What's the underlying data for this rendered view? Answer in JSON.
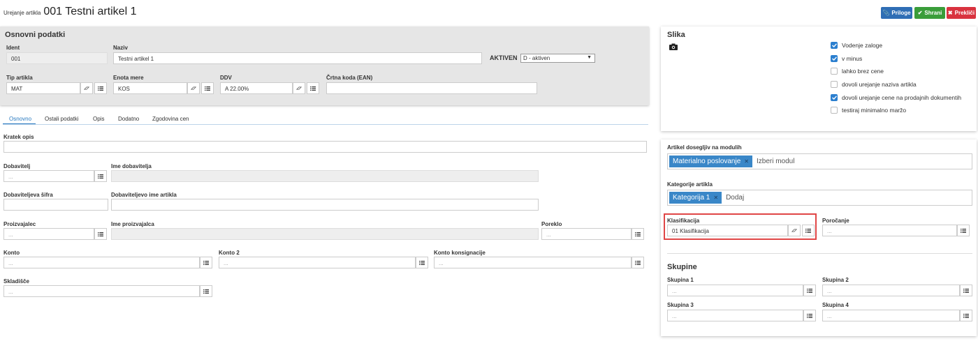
{
  "header": {
    "subtitle": "Urejanje artikla",
    "title": "001 Testni artikel 1",
    "buttons": {
      "priloge": "Priloge",
      "shrani": "Shrani",
      "preklici": "Prekliči"
    }
  },
  "basic": {
    "section_title": "Osnovni podatki",
    "ident_label": "Ident",
    "ident_value": "001",
    "naziv_label": "Naziv",
    "naziv_value": "Testni artikel 1",
    "aktiven_label": "AKTIVEN",
    "aktiven_value": "D - aktiven",
    "tip_label": "Tip artikla",
    "tip_value": "MAT",
    "enota_label": "Enota mere",
    "enota_value": "KOS",
    "ddv_label": "DDV",
    "ddv_value": "A 22.00%",
    "ean_label": "Črtna koda (EAN)",
    "ean_value": ""
  },
  "tabs": [
    {
      "label": "Osnovno",
      "active": true
    },
    {
      "label": "Ostali podatki",
      "active": false
    },
    {
      "label": "Opis",
      "active": false
    },
    {
      "label": "Dodatno",
      "active": false
    },
    {
      "label": "Zgodovina cen",
      "active": false
    }
  ],
  "form": {
    "kratek_opis_label": "Kratek opis",
    "dobavitelj_label": "Dobavitelj",
    "dobavitelj_placeholder": "...",
    "ime_dobavitelja_label": "Ime dobavitelja",
    "dob_sifra_label": "Dobaviteljeva šifra",
    "dob_ime_artikla_label": "Dobaviteljevo ime artikla",
    "proizvajalec_label": "Proizvajalec",
    "proizvajalec_placeholder": "...",
    "ime_proizvajalca_label": "Ime proizvajalca",
    "poreklo_label": "Poreklo",
    "poreklo_placeholder": "...",
    "konto_label": "Konto",
    "konto_placeholder": "...",
    "konto2_label": "Konto 2",
    "konto2_placeholder": "...",
    "konto_konsig_label": "Konto konsignacije",
    "konto_konsig_placeholder": "...",
    "skladisce_label": "Skladišče",
    "skladisce_placeholder": "..."
  },
  "slika": {
    "title": "Slika",
    "checkboxes": [
      {
        "label": "Vodenje zaloge",
        "checked": true
      },
      {
        "label": "v minus",
        "checked": true
      },
      {
        "label": "lahko brez cene",
        "checked": false
      },
      {
        "label": "dovoli urejanje naziva artikla",
        "checked": false
      },
      {
        "label": "dovoli urejanje cene na prodajnih dokumentih",
        "checked": true
      },
      {
        "label": "testiraj minimalno maržo",
        "checked": false
      }
    ]
  },
  "right": {
    "moduli_label": "Artikel dosegljiv na modulih",
    "moduli_tag": "Materialno poslovanje",
    "moduli_placeholder": "Izberi modul",
    "kategorije_label": "Kategorije artikla",
    "kategorije_tag": "Kategorija 1",
    "kategorije_placeholder": "Dodaj",
    "klasifikacija_label": "Klasifikacija",
    "klasifikacija_value": "01 Klasifikacija",
    "porocanje_label": "Poročanje",
    "porocanje_placeholder": "...",
    "skupine_title": "Skupine",
    "skupina1_label": "Skupina 1",
    "skupina2_label": "Skupina 2",
    "skupina3_label": "Skupina 3",
    "skupina4_label": "Skupina 4",
    "skupina_placeholder": "..."
  },
  "colors": {
    "priloge": "#2f6eb5",
    "shrani": "#3a9d3a",
    "preklici": "#d9333f",
    "highlight": "#e04646",
    "tab_active": "#2a7ac0"
  }
}
